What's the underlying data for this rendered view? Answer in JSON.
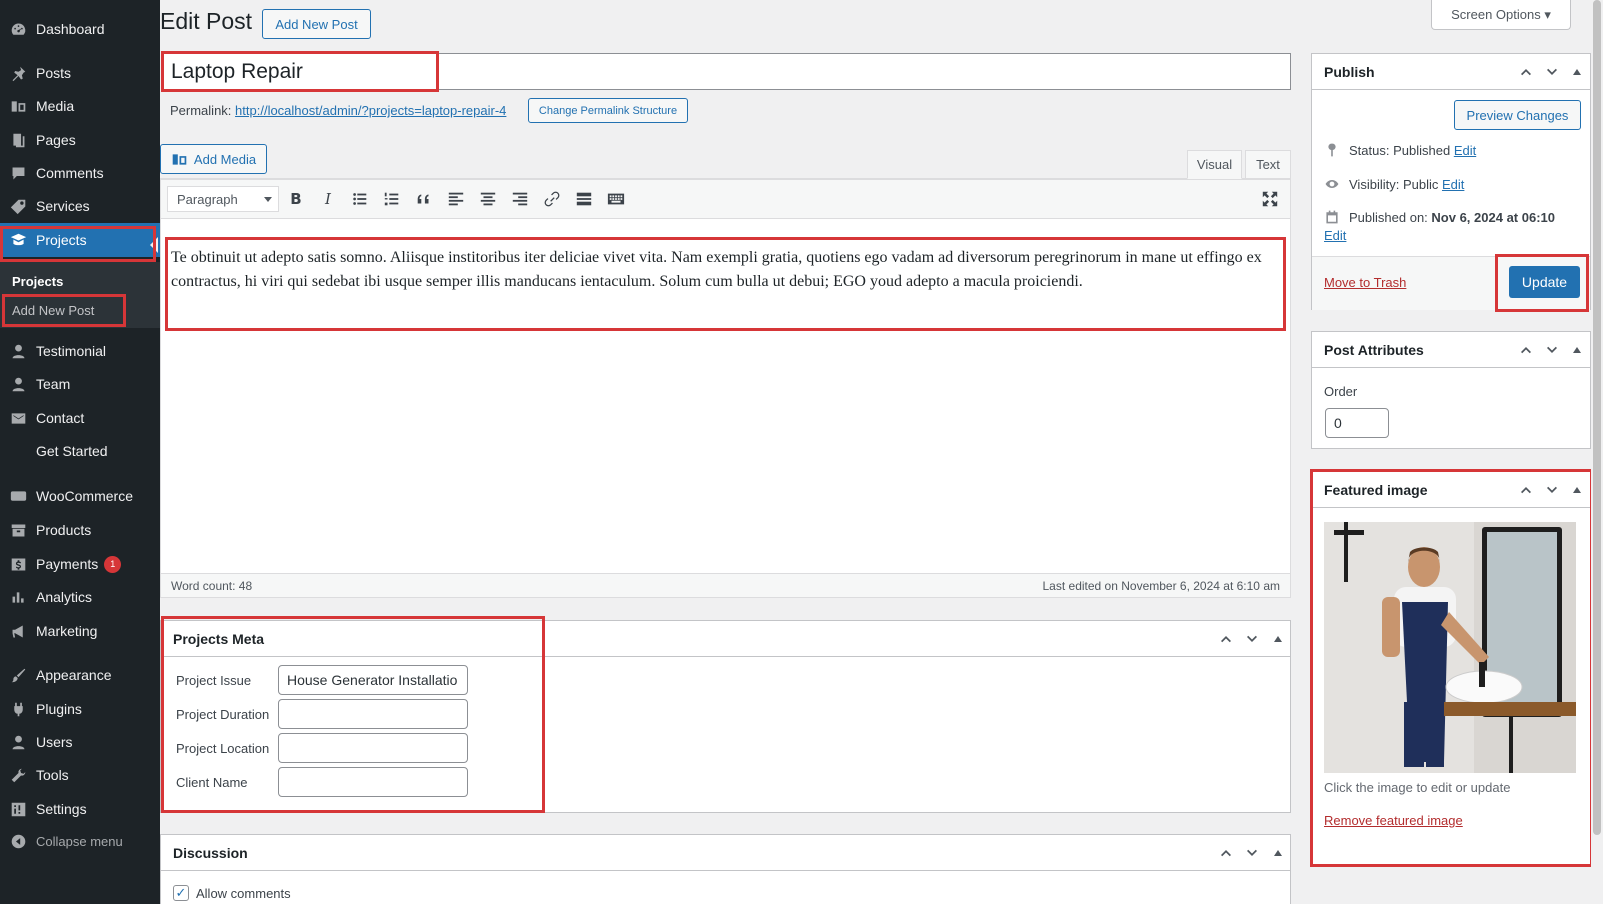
{
  "sidebar": {
    "items": [
      {
        "label": "Dashboard",
        "icon": "dashboard-icon"
      },
      {
        "label": "Posts",
        "icon": "pin-icon"
      },
      {
        "label": "Media",
        "icon": "media-icon"
      },
      {
        "label": "Pages",
        "icon": "pages-icon"
      },
      {
        "label": "Comments",
        "icon": "comment-icon"
      },
      {
        "label": "Services",
        "icon": "tag-icon"
      },
      {
        "label": "Projects",
        "icon": "portfolio-icon"
      },
      {
        "label": "Testimonial",
        "icon": "user-icon"
      },
      {
        "label": "Team",
        "icon": "user-icon"
      },
      {
        "label": "Contact",
        "icon": "mail-icon"
      },
      {
        "label": "Get Started",
        "icon": ""
      },
      {
        "label": "WooCommerce",
        "icon": "woo-icon"
      },
      {
        "label": "Products",
        "icon": "archive-icon"
      },
      {
        "label": "Payments",
        "icon": "dollar-icon",
        "badge": "1"
      },
      {
        "label": "Analytics",
        "icon": "chart-icon"
      },
      {
        "label": "Marketing",
        "icon": "megaphone-icon"
      },
      {
        "label": "Appearance",
        "icon": "brush-icon"
      },
      {
        "label": "Plugins",
        "icon": "plug-icon"
      },
      {
        "label": "Users",
        "icon": "user-icon"
      },
      {
        "label": "Tools",
        "icon": "wrench-icon"
      },
      {
        "label": "Settings",
        "icon": "settings-icon"
      },
      {
        "label": "Collapse menu",
        "icon": "collapse-icon"
      }
    ],
    "submenu": {
      "heading": "Projects",
      "add_new": "Add New Post"
    }
  },
  "header": {
    "title": "Edit Post",
    "add_new": "Add New Post",
    "screen_options": "Screen Options ▾"
  },
  "post": {
    "title": "Laptop Repair",
    "permalink_label": "Permalink:",
    "permalink_url": "http://localhost/admin/?projects=laptop-repair-4",
    "change_permalink": "Change Permalink Structure",
    "add_media": "Add Media",
    "tab_visual": "Visual",
    "tab_text": "Text",
    "format": "Paragraph",
    "content": "Te obtinuit ut adepto satis somno. Aliisque institoribus iter deliciae vivet vita. Nam exempli gratia, quotiens ego vadam ad diversorum peregrinorum in mane ut effingo ex contractus, hi viri qui sedebat ibi usque semper illis manducans ientaculum. Solum cum bulla ut debui; EGO youd adepto a macula proiciendi.",
    "word_count": "Word count: 48",
    "last_edited": "Last edited on November 6, 2024 at 6:10 am"
  },
  "projects_meta": {
    "title": "Projects Meta",
    "fields": [
      {
        "label": "Project Issue",
        "value": "House Generator Installatio"
      },
      {
        "label": "Project Duration",
        "value": ""
      },
      {
        "label": "Project Location",
        "value": ""
      },
      {
        "label": "Client Name",
        "value": ""
      }
    ]
  },
  "discussion": {
    "title": "Discussion",
    "allow_comments": "Allow comments"
  },
  "publish": {
    "title": "Publish",
    "preview": "Preview Changes",
    "status_label": "Status: Published",
    "visibility_label": "Visibility: Public",
    "published_on_label": "Published on:",
    "published_on_value": "Nov 6, 2024 at 06:10",
    "edit": "Edit",
    "trash": "Move to Trash",
    "update": "Update"
  },
  "attributes": {
    "title": "Post Attributes",
    "order_label": "Order",
    "order_value": "0"
  },
  "featured": {
    "title": "Featured image",
    "hint": "Click the image to edit or update",
    "remove": "Remove featured image"
  },
  "colors": {
    "accent": "#2271b1",
    "sidebar": "#1d2327",
    "highlight": "#d63638"
  }
}
